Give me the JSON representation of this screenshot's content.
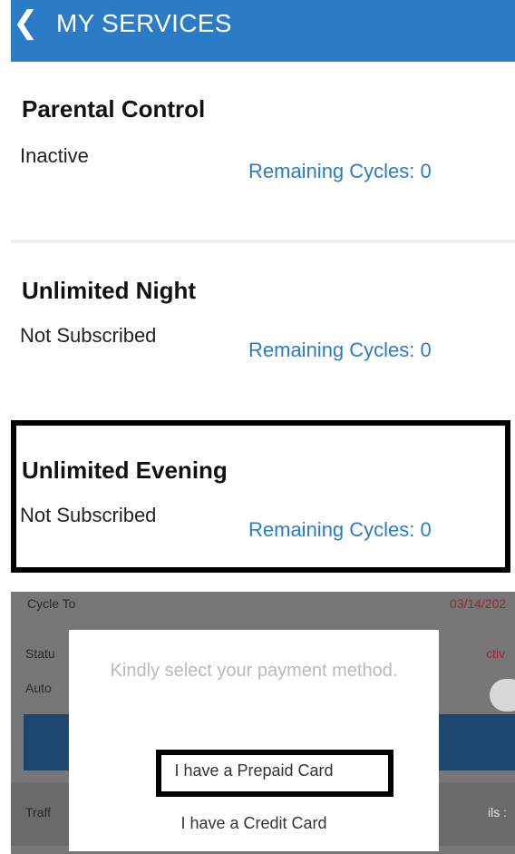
{
  "header": {
    "title": "MY SERVICES",
    "back_icon": "chevron-left-icon"
  },
  "services": [
    {
      "name": "Parental Control",
      "status": "Inactive",
      "cycles": "Remaining Cycles: 0"
    },
    {
      "name": "Unlimited Night",
      "status": "Not Subscribed",
      "cycles": "Remaining Cycles: 0"
    },
    {
      "name": "Unlimited Evening",
      "status": "Not Subscribed",
      "cycles": "Remaining Cycles: 0"
    }
  ],
  "background": {
    "cycle_to_label": "Cycle To",
    "cycle_to_value": "03/14/202",
    "status_label": "Statu",
    "status_value": "ctiv",
    "auto_label": "Auto",
    "traffic_label": "Traff",
    "details_label": "ils :"
  },
  "dialog": {
    "prompt": "Kindly select your payment method.",
    "prepaid": "I have a Prepaid Card",
    "credit": "I have a Credit Card"
  },
  "colors": {
    "accent": "#2a7cc7",
    "overlay": "#777777"
  }
}
